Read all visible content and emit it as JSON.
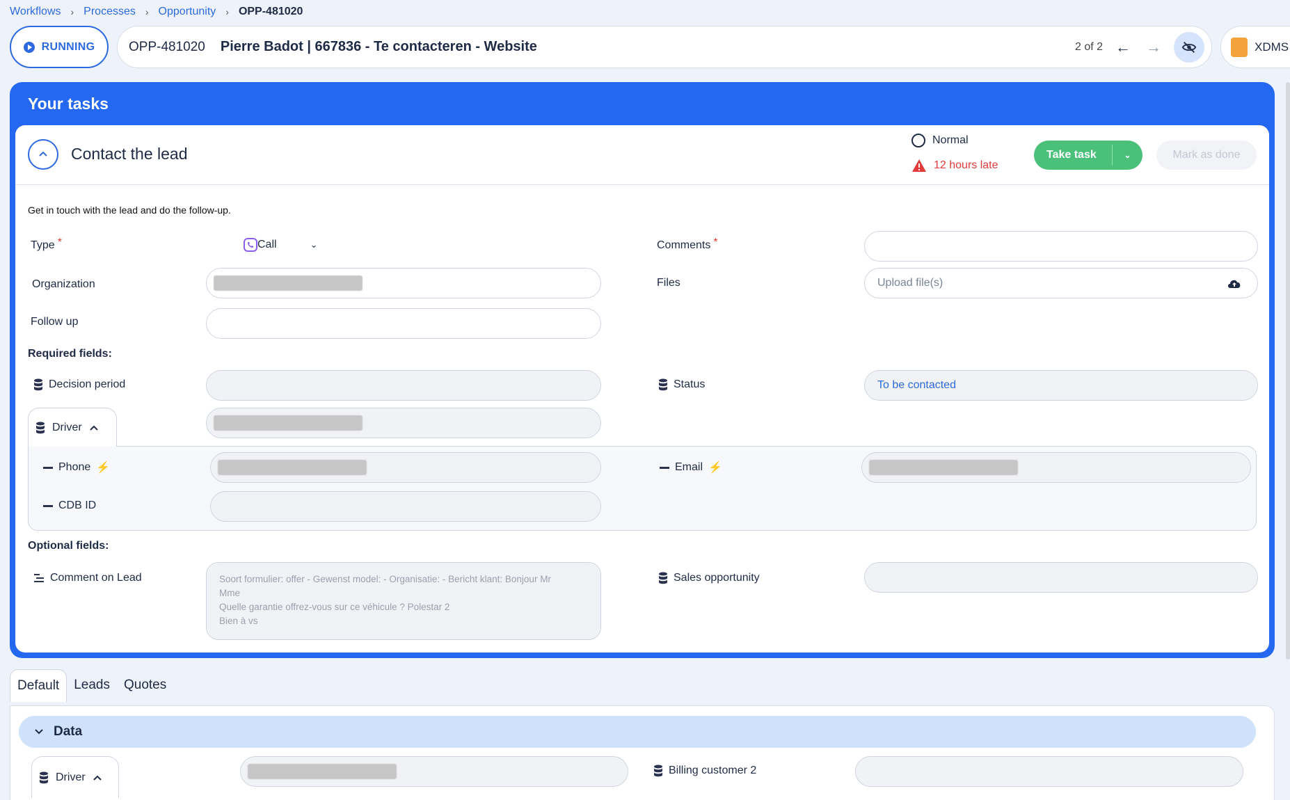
{
  "breadcrumb": {
    "items": [
      "Workflows",
      "Processes",
      "Opportunity"
    ],
    "current": "OPP-481020"
  },
  "header": {
    "status": "RUNNING",
    "opp_id": "OPP-481020",
    "opp_name": "Pierre Badot | 667836 - Te contacteren - Website",
    "pager": "2 of 2",
    "side_doc_label": "XDMS"
  },
  "tasks": {
    "panel_title": "Your tasks",
    "task": {
      "title": "Contact the lead",
      "priority": "Normal",
      "late": "12 hours late",
      "take_task": "Take task",
      "mark_done": "Mark as done",
      "description": "Get in touch with the lead and do the follow-up.",
      "fields": {
        "type_label": "Type",
        "type_value": "Call",
        "comments_label": "Comments",
        "organization_label": "Organization",
        "files_label": "Files",
        "files_placeholder": "Upload file(s)",
        "follow_up_label": "Follow up"
      },
      "required_title": "Required fields:",
      "required": {
        "decision_period": "Decision period",
        "status_label": "Status",
        "status_value": "To be contacted",
        "driver": "Driver",
        "phone": "Phone",
        "email": "Email",
        "cdb_id": "CDB ID"
      },
      "optional_title": "Optional fields:",
      "optional": {
        "comment_on_lead": "Comment on Lead",
        "comment_text": [
          "Soort formulier: offer - Gewenst model:  - Organisatie:  - Bericht klant: Bonjour Mr",
          "Mme",
          "Quelle garantie offrez-vous sur ce véhicule ? Polestar 2",
          "Bien à vs"
        ],
        "sales_opportunity": "Sales opportunity"
      }
    }
  },
  "bottom": {
    "tabs": [
      "Default",
      "Leads",
      "Quotes"
    ],
    "active_tab": "Default",
    "section": "Data",
    "driver": "Driver",
    "billing_customer": "Billing customer 2"
  },
  "colors": {
    "accent": "#2468f2",
    "success": "#4ac07a",
    "danger": "#e23b3b",
    "bolt": "#f2b62c"
  }
}
